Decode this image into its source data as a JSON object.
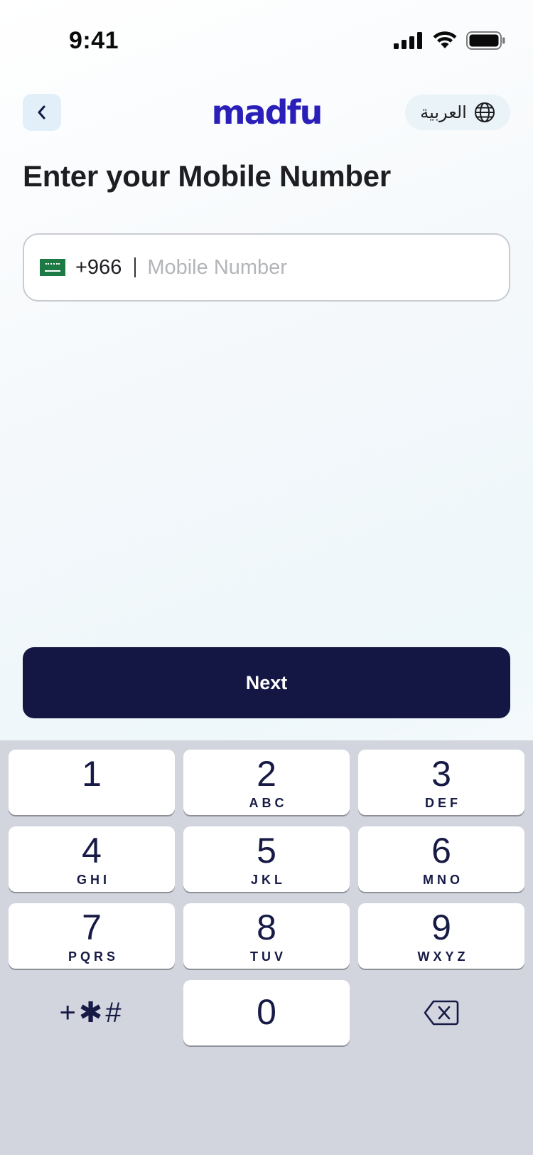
{
  "status_bar": {
    "time": "9:41"
  },
  "header": {
    "logo_text": "madfu",
    "language_label": "العربية"
  },
  "title": "Enter your Mobile Number",
  "phone": {
    "country_code": "+966",
    "placeholder": "Mobile Number",
    "value": ""
  },
  "next_label": "Next",
  "keypad": {
    "keys": [
      {
        "digit": "1",
        "letters": ""
      },
      {
        "digit": "2",
        "letters": "ABC"
      },
      {
        "digit": "3",
        "letters": "DEF"
      },
      {
        "digit": "4",
        "letters": "GHI"
      },
      {
        "digit": "5",
        "letters": "JKL"
      },
      {
        "digit": "6",
        "letters": "MNO"
      },
      {
        "digit": "7",
        "letters": "PQRS"
      },
      {
        "digit": "8",
        "letters": "TUV"
      },
      {
        "digit": "9",
        "letters": "WXYZ"
      },
      {
        "digit": "0",
        "letters": ""
      }
    ],
    "symbols": "+✱#"
  },
  "colors": {
    "brand": "#2a1fb8",
    "button": "#141743",
    "key_text": "#161a45",
    "keyboard_bg": "#d2d5de"
  }
}
